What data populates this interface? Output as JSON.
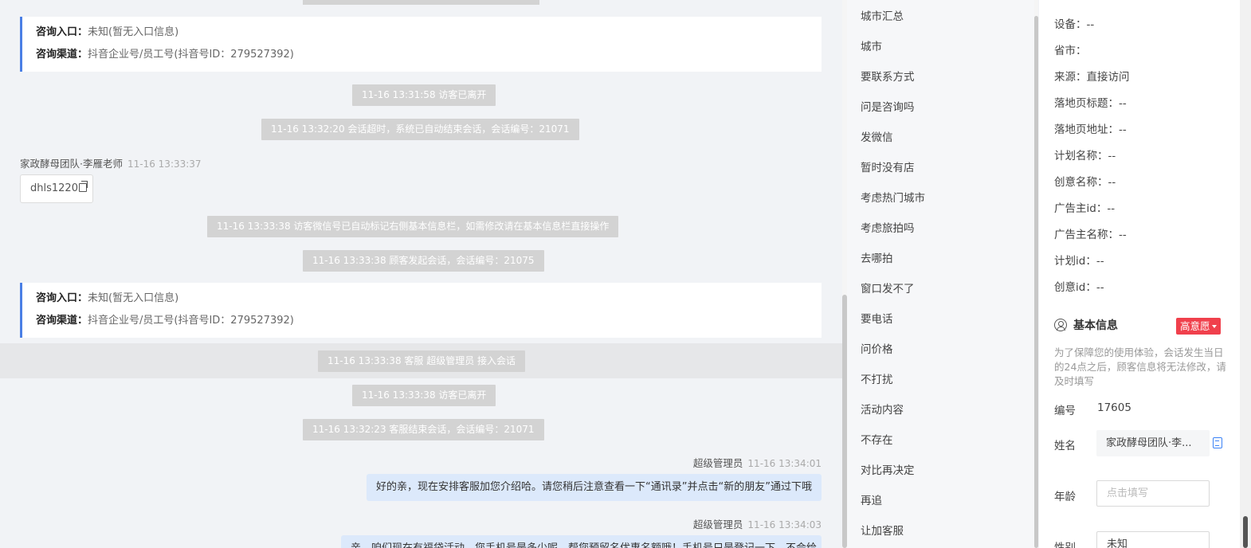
{
  "chat": {
    "card_entry_label": "咨询入口：",
    "card_entry_value": "未知(暂无入口信息)",
    "card_channel_label": "咨询渠道：",
    "card_channel_value": "抖音企业号/员工号(抖音号ID：279527392)",
    "sys1": "11-16 13:31:58 访客已离开",
    "sys2": "11-16 13:32:20 会话超时，系统已自动结束会话，会话编号：21071",
    "visitor_name": "家政酵母团队·李雁老师",
    "visitor_time": "11-16 13:33:37",
    "wechat_id": "dhls1220",
    "sys3": "11-16 13:33:38 访客微信号已自动标记右侧基本信息栏，如需修改请在基本信息栏直接操作",
    "sys4": "11-16 13:33:38 顾客发起会话，会话编号：21075",
    "sys5": "11-16 13:33:38 客服 超级管理员 接入会话",
    "sys6": "11-16 13:33:38 访客已离开",
    "sys7": "11-16 13:32:23 客服结束会话，会话编号：21071",
    "agent_name": "超级管理员",
    "agent_time1": "11-16 13:34:01",
    "agent_msg1": "好的亲，现在安排客服加您介绍哈。请您稍后注意查看一下“通讯录”并点击“新的朋友”通过下哦",
    "agent_time2": "11-16 13:34:03",
    "agent_msg2": "亲，咱们现在有福袋活动，您手机号是多少呢，帮您预留名优惠名额哦！手机号只是登记一下，不会给"
  },
  "tags": [
    "城市汇总",
    "城市",
    "要联系方式",
    "问是咨询吗",
    "发微信",
    "暂时没有店",
    "考虑热门城市",
    "考虑旅拍吗",
    "去哪拍",
    "窗口发不了",
    "要电话",
    "问价格",
    "不打扰",
    "活动内容",
    "不存在",
    "对比再决定",
    "再追",
    "让加客服"
  ],
  "source_info": [
    {
      "label": "设备：",
      "value": "--"
    },
    {
      "label": "省市：",
      "value": ""
    },
    {
      "label": "来源：",
      "value": "直接访问"
    },
    {
      "label": "落地页标题：",
      "value": "--"
    },
    {
      "label": "落地页地址：",
      "value": "--"
    },
    {
      "label": "计划名称：",
      "value": "--"
    },
    {
      "label": "创意名称：",
      "value": "--"
    },
    {
      "label": "广告主id：",
      "value": "--"
    },
    {
      "label": "广告主名称：",
      "value": "--"
    },
    {
      "label": "计划id：",
      "value": "--"
    },
    {
      "label": "创意id：",
      "value": "--"
    }
  ],
  "basic": {
    "title": "基本信息",
    "intent_badge": "高意愿",
    "notice": "为了保障您的使用体验，会话发生当日的24点之后，顾客信息将无法修改，请及时填写",
    "id_label": "编号",
    "id_value": "17605",
    "name_label": "姓名",
    "name_value": "家政酵母团队·李...",
    "age_label": "年龄",
    "age_placeholder": "点击填写",
    "gender_label": "性别",
    "gender_value": "未知"
  }
}
